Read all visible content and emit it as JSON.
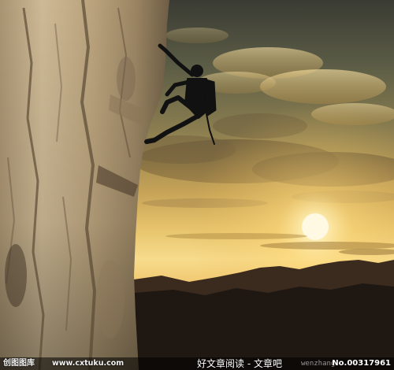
{
  "watermark": {
    "brand": "创图图库",
    "url": "www.cxtuku.com",
    "reading_site": "好文章阅读 - 文章吧",
    "reading_url": "wenzhang",
    "image_id": "No.00317961"
  },
  "colors": {
    "sky_top": "#3a3b33",
    "sky_mid": "#b69a4e",
    "horizon_glow": "#f4d27a",
    "sun": "#fff6d8",
    "mountain": "#1f1712",
    "rock_light": "#c9b48c",
    "rock_dark": "#6b5a44",
    "silhouette": "#111111"
  },
  "icons": [
    "climber-silhouette",
    "sun",
    "cliff-rock",
    "mountain-range"
  ]
}
